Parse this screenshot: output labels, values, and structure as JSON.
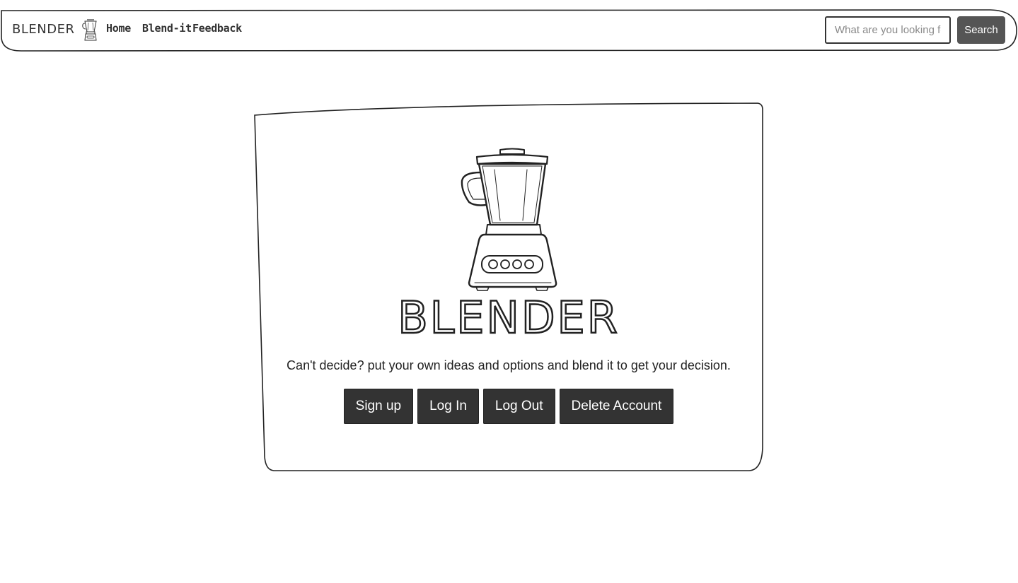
{
  "navbar": {
    "brand": "BLENDER",
    "brand_icon": "blender-icon",
    "links": [
      "Home",
      "Blend-it",
      "Feedback"
    ],
    "search": {
      "placeholder": "What are you looking for?",
      "button_label": "Search"
    }
  },
  "hero": {
    "image": "blender-illustration",
    "title": "BLENDER",
    "tagline": "Can't decide? put your own ideas and options and blend it to get your decision.",
    "buttons": [
      "Sign up",
      "Log In",
      "Log Out",
      "Delete Account"
    ]
  },
  "colors": {
    "button_bg": "#333333",
    "search_button_bg": "#555555",
    "text": "#222222"
  }
}
